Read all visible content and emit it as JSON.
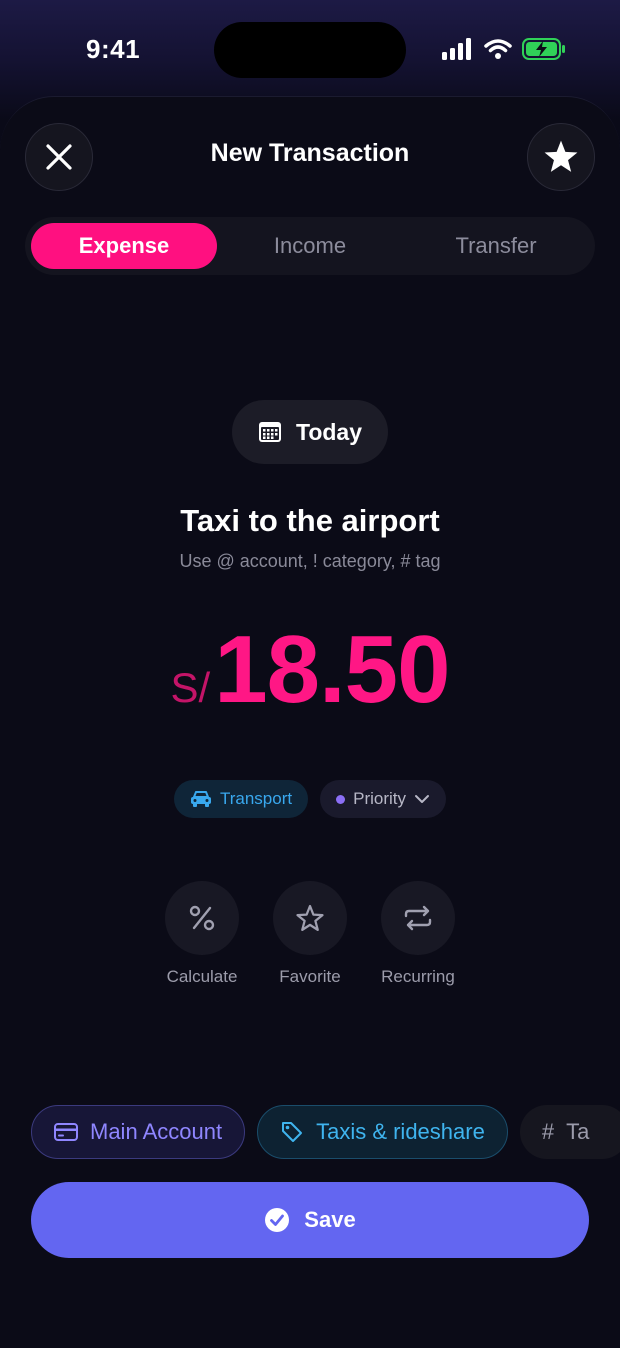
{
  "status_bar": {
    "time": "9:41"
  },
  "header": {
    "title": "New Transaction"
  },
  "segments": [
    {
      "label": "Expense",
      "active": true
    },
    {
      "label": "Income",
      "active": false
    },
    {
      "label": "Transfer",
      "active": false
    }
  ],
  "date": {
    "label": "Today"
  },
  "transaction": {
    "title": "Taxi to the airport",
    "hint": "Use @ account, ! category, # tag",
    "currency": "S/",
    "amount": "18.50"
  },
  "chips": {
    "transport": "Transport",
    "priority": "Priority"
  },
  "actions": [
    {
      "label": "Calculate",
      "icon": "percent-icon"
    },
    {
      "label": "Favorite",
      "icon": "star-outline-icon"
    },
    {
      "label": "Recurring",
      "icon": "repeat-icon"
    }
  ],
  "bottom_chips": {
    "account": "Main Account",
    "category": "Taxis & rideshare",
    "tag": "Ta"
  },
  "save_button": {
    "label": "Save"
  },
  "colors": {
    "accent": "#ff1080",
    "save": "#6366f1",
    "battery": "#30d158"
  }
}
